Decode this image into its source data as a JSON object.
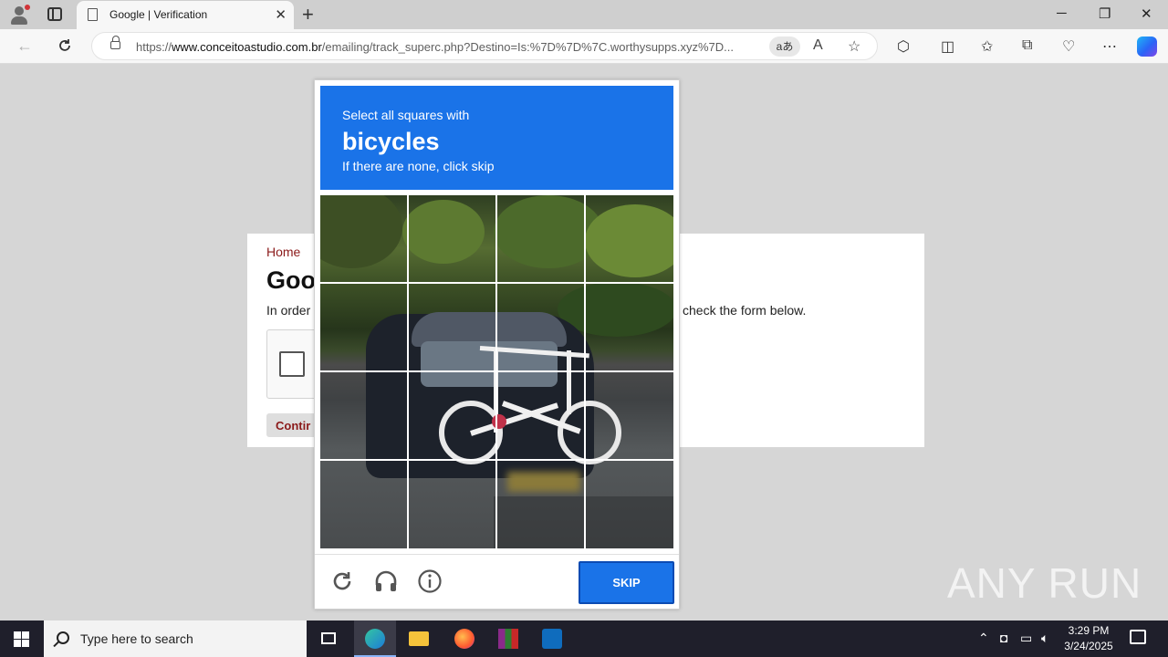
{
  "browser": {
    "tab_title": "Google | Verification",
    "url_prefix": "https://",
    "url_domain": "www.conceitoastudio.com.br",
    "url_path": "/emailing/track_superc.php?Destino=Is:%7D%7D%7C.worthysupps.xyz%7D...",
    "read_aloud_label": "aあ",
    "accent_color": "#1a73e8"
  },
  "page": {
    "breadcrumb": "Home",
    "title_visible": "Goo",
    "text_left": "In order",
    "text_right": "check the form below.",
    "continue_visible": "Contir"
  },
  "challenge": {
    "line1": "Select all squares with",
    "target": "bicycles",
    "line3": "If there are none, click skip",
    "grid_size": "4x4",
    "skip_label": "SKIP",
    "icons": [
      "reload-icon",
      "audio-icon",
      "info-icon"
    ]
  },
  "watermark": "ANY RUN",
  "taskbar": {
    "search_placeholder": "Type here to search",
    "time": "3:29 PM",
    "date": "3/24/2025",
    "apps": [
      "task-view",
      "edge",
      "file-explorer",
      "firefox",
      "winrar",
      "outlook"
    ]
  }
}
